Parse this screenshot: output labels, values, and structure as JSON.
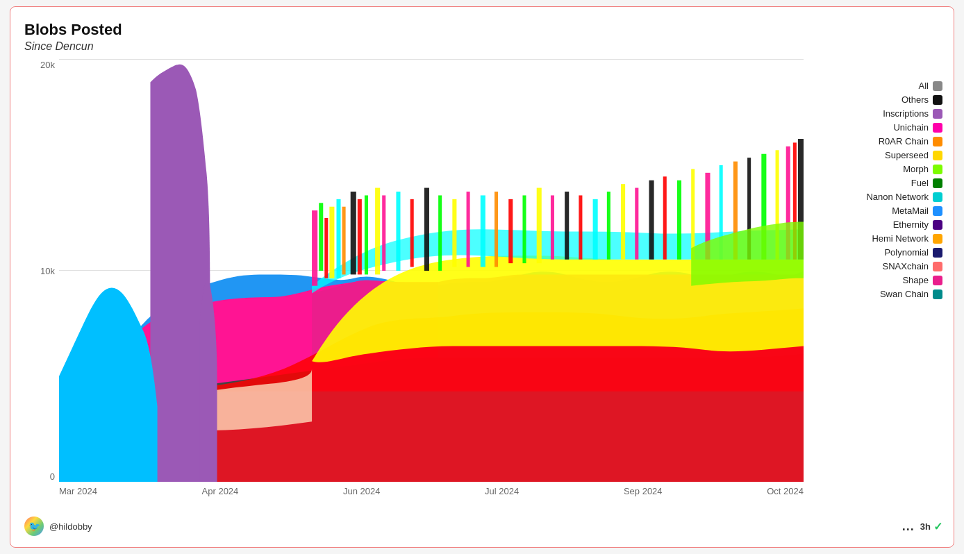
{
  "title": "Blobs Posted",
  "subtitle": "Since Dencun",
  "yAxis": {
    "labels": [
      "0",
      "10k",
      "20k"
    ]
  },
  "xAxis": {
    "labels": [
      "Mar 2024",
      "Apr 2024",
      "Jun 2024",
      "Jul 2024",
      "Sep 2024",
      "Oct 2024"
    ]
  },
  "legend": {
    "items": [
      {
        "label": "All",
        "color": "#888888"
      },
      {
        "label": "Others",
        "color": "#111111"
      },
      {
        "label": "Inscriptions",
        "color": "#9b59b6"
      },
      {
        "label": "Unichain",
        "color": "#ff00aa"
      },
      {
        "label": "R0AR Chain",
        "color": "#ff8c00"
      },
      {
        "label": "Superseed",
        "color": "#ffd700"
      },
      {
        "label": "Morph",
        "color": "#7cfc00"
      },
      {
        "label": "Fuel",
        "color": "#008000"
      },
      {
        "label": "Nanon Network",
        "color": "#00ced1"
      },
      {
        "label": "MetaMail",
        "color": "#1e90ff"
      },
      {
        "label": "Ethernity",
        "color": "#4b0082"
      },
      {
        "label": "Hemi Network",
        "color": "#ffa500"
      },
      {
        "label": "Polynomial",
        "color": "#1a1a6e"
      },
      {
        "label": "SNAXchain",
        "color": "#ff6b6b"
      },
      {
        "label": "Shape",
        "color": "#e91e8c"
      },
      {
        "label": "Swan Chain",
        "color": "#008b8b"
      }
    ]
  },
  "footer": {
    "avatar": "🐦",
    "username": "@hildobby",
    "dots": "...",
    "time": "3h"
  }
}
